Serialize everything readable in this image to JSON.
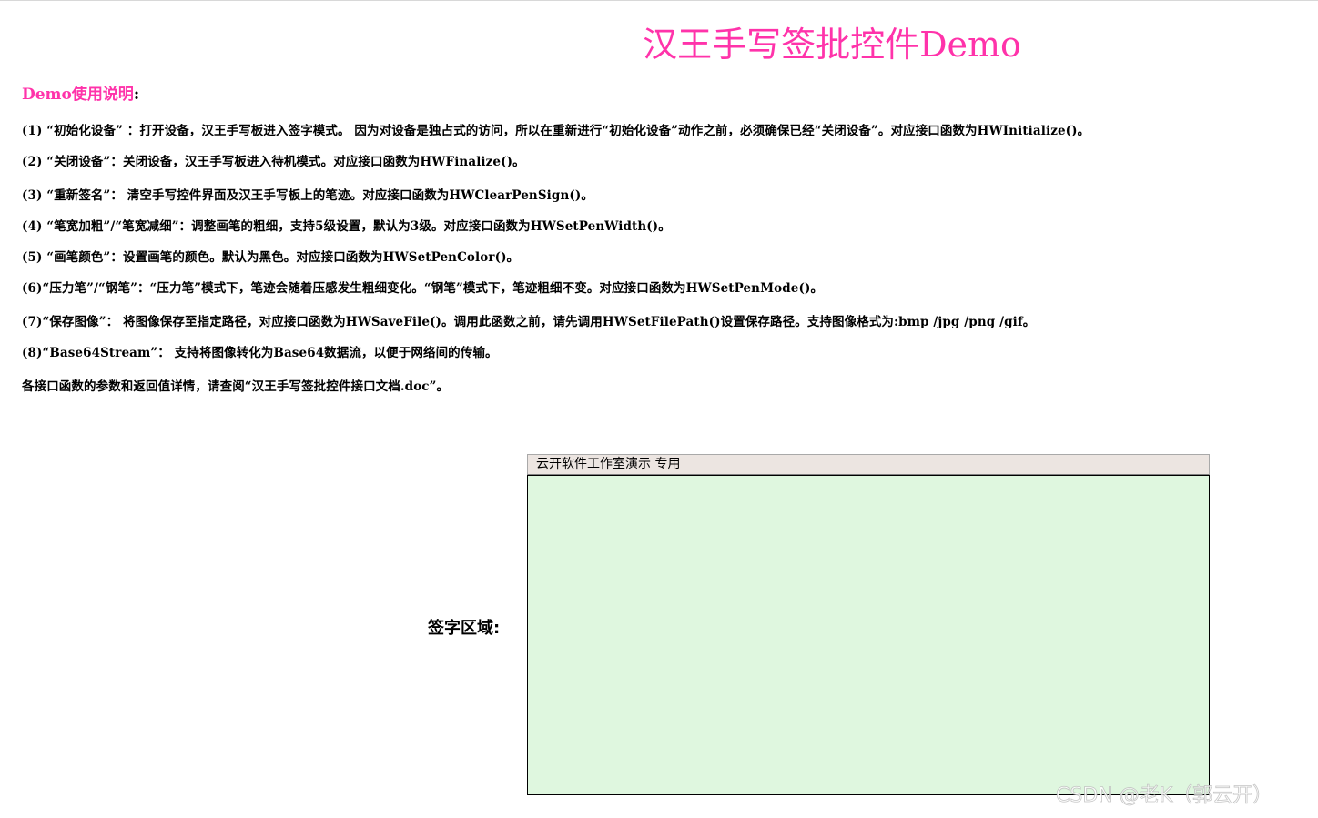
{
  "page": {
    "title": "汉王手写签批控件Demo"
  },
  "usage": {
    "heading": "Demo使用说明",
    "heading_colon": ":",
    "items": [
      "(1) “初始化设备” ：打开设备，汉王手写板进入签字模式。 因为对设备是独占式的访问，所以在重新进行“初始化设备”动作之前，必须确保已经“关闭设备”。对应接口函数为HWInitialize()。",
      "(2) “关闭设备”：关闭设备，汉王手写板进入待机模式。对应接口函数为HWFinalize()。",
      "(3) “重新签名”： 清空手写控件界面及汉王手写板上的笔迹。对应接口函数为HWClearPenSign()。",
      "(4) “笔宽加粗”/“笔宽减细”：调整画笔的粗细，支持5级设置，默认为3级。对应接口函数为HWSetPenWidth()。",
      "(5) “画笔颜色”：设置画笔的颜色。默认为黑色。对应接口函数为HWSetPenColor()。",
      "(6)“压力笔”/“钢笔”：“压力笔”模式下，笔迹会随着压感发生粗细变化。“钢笔”模式下，笔迹粗细不变。对应接口函数为HWSetPenMode()。",
      "(7)“保存图像”： 将图像保存至指定路径，对应接口函数为HWSaveFile()。调用此函数之前，请先调用HWSetFilePath()设置保存路径。支持图像格式为:bmp /jpg /png /gif。",
      "(8)“Base64Stream”： 支持将图像转化为Base64数据流，以便于网络间的传输。",
      "各接口函数的参数和返回值详情，请查阅“汉王手写签批控件接口文档.doc”。"
    ]
  },
  "signature": {
    "label": "签字区域:",
    "control_caption": "云开软件工作室演示  专用"
  },
  "watermark": {
    "text": "CSDN @老K（郭云开）"
  },
  "colors": {
    "title": "#ff33aa",
    "canvas_bg": "#dff7df",
    "caption_bg": "#ece5e1"
  }
}
